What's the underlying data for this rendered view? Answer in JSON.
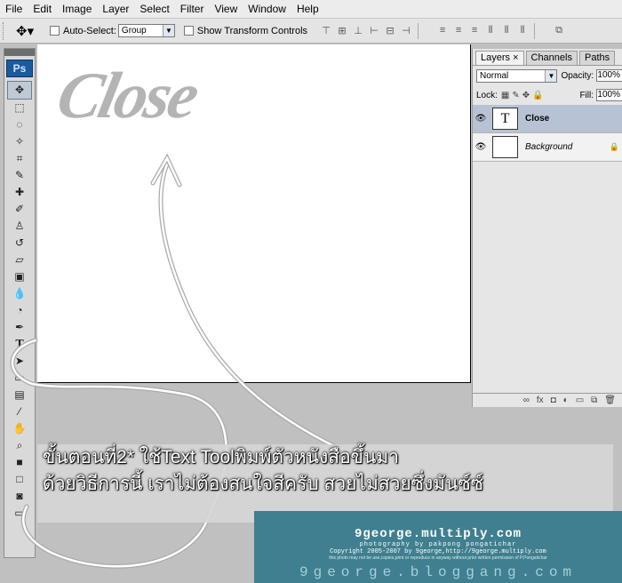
{
  "menu": {
    "items": [
      "File",
      "Edit",
      "Image",
      "Layer",
      "Select",
      "Filter",
      "View",
      "Window",
      "Help"
    ]
  },
  "options": {
    "auto_select_label": "Auto-Select:",
    "auto_select_value": "Group",
    "transform_label": "Show Transform Controls"
  },
  "toolbox": {
    "logo": "Ps",
    "text_tool": "T"
  },
  "canvas": {
    "art_text": "Close"
  },
  "layers_panel": {
    "tabs": [
      "Layers ×",
      "Channels",
      "Paths"
    ],
    "blend_mode": "Normal",
    "opacity_label": "Opacity:",
    "opacity_value": "100%",
    "lock_label": "Lock:",
    "fill_label": "Fill:",
    "fill_value": "100%",
    "layers": [
      {
        "thumb": "T",
        "name": "Close"
      },
      {
        "thumb": "",
        "name": "Background"
      }
    ]
  },
  "instruction": {
    "line1": "ขั้นตอนที่2* ใช้Text Toolพิมพ์ตัวหนังสือขึ้นมา",
    "line2": "ด้วยวิธีการนี้ เราไม่ต้องสนใจสีครับ สวยไม่สวยซึ่งมันซ์ซ์"
  },
  "watermark": {
    "site": "9george.multiply.com",
    "photo_credit": "photography by pakpong pongatichar",
    "copyright": "Copyright 2005-2007 by 9george,http://9george.multiply.com",
    "notice": "this photo may not be use,copies,print or reproduce in anyway without prior written permission of P.Pongatichar",
    "blog": "9george.bloggang.com"
  }
}
